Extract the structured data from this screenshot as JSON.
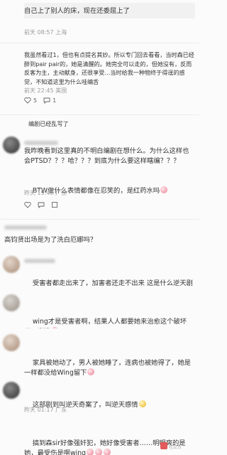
{
  "comments": [
    {
      "text": "自己上了别人的床，现在还委屈上了",
      "meta": "前天 08:57 上海"
    },
    {
      "text": "我虽然看过1，但也有点提名其妙。所以专门回去看看，当时森已经醉到pair pair的，她是清醒的。她完全可以走的，但她没有，反而反客为主，主动献身，还很享受…当时给我一种物终于得逞的感觉，不知道这里为什么哇编舌",
      "meta": "前天 22:45 美国",
      "likes": "5",
      "comments_count": "1"
    },
    {
      "text": "编剧已经乱写了"
    },
    {
      "text": "我昨晚看到这里真的不明白编剧在想什么。为什么这样也会PTSD？？？哈？？？到底为什么要这样瞎编？？？",
      "text2": "BTW做什么表情都像在忍笑的，是红药水吗",
      "meta": "昨天 19:40 广东"
    },
    {
      "text": "高钧贤出场是为了洗白厄娜吗？"
    },
    {
      "text": "受害者都走出来了，加害者还走不出来 这是什么逆天剧情"
    },
    {
      "text": "wing才是受害者啊，结果人人都要她来治愈这个破坏者，真惨"
    },
    {
      "text": "家具被她动了，男人被她睡了，连病也被她得了，她是一样都没给Wing留下"
    },
    {
      "text": "这部剧到叫逆天奇案了，叫逆天感情",
      "meta": "昨天 01:17 广东"
    },
    {
      "text": "搞到森sir好像强奸犯，她好像受害者……明明爽的是她，最受伤是啊wing"
    }
  ],
  "icons": {
    "like": "heart-icon",
    "comment": "comment-icon",
    "dislike": "thumb-down-icon",
    "share": "share-icon"
  },
  "watermark": "吃瓜台"
}
